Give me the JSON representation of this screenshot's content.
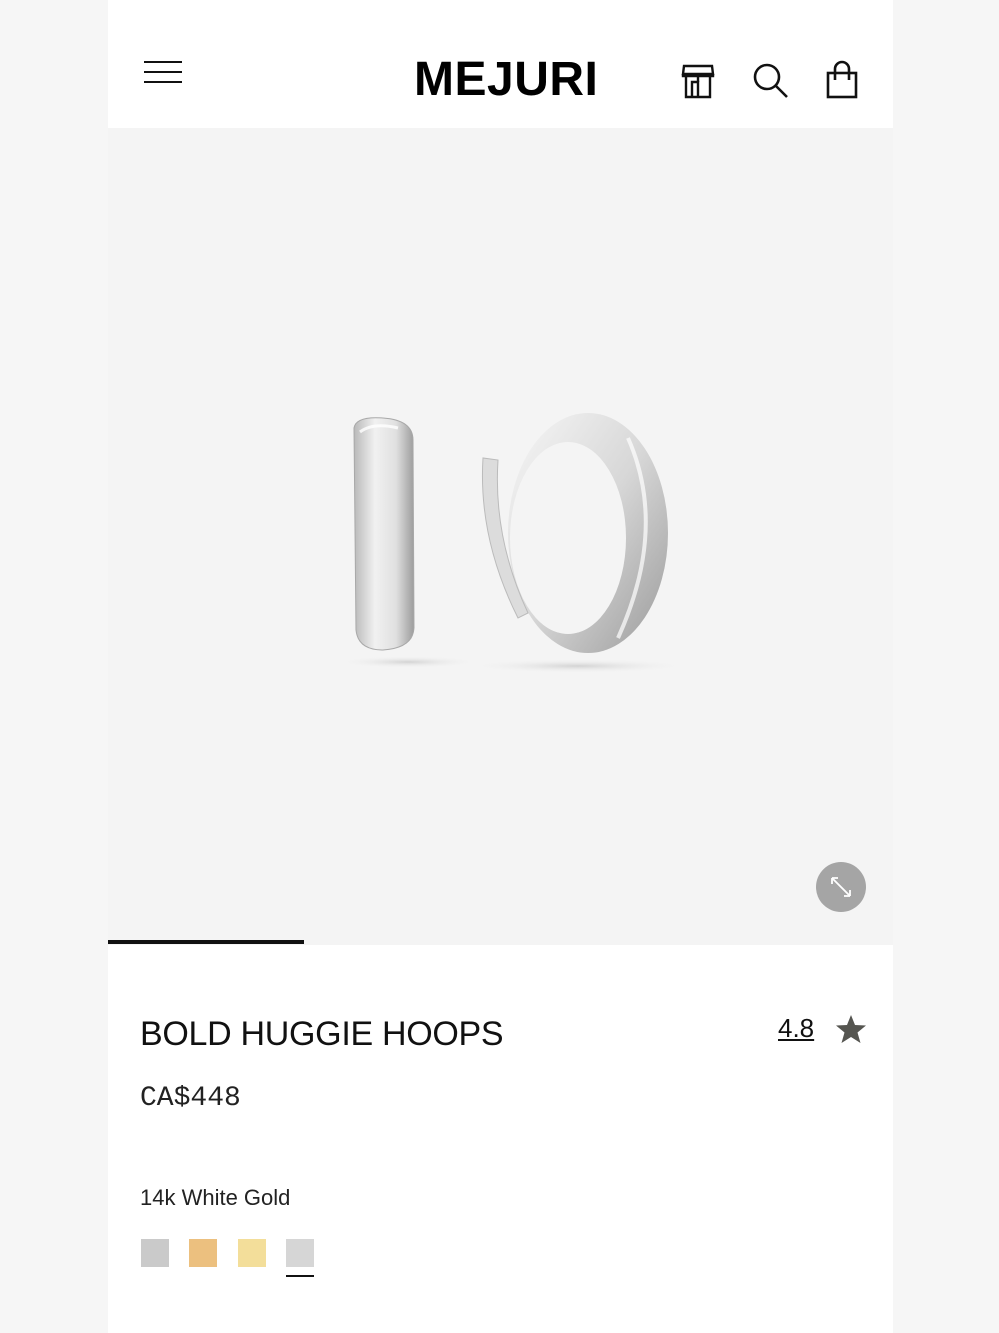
{
  "header": {
    "logo": "MEJURI",
    "icons": [
      "menu-icon",
      "store-icon",
      "search-icon",
      "bag-icon"
    ]
  },
  "gallery": {
    "image_alt": "Bold Huggie Hoops in 14k white gold",
    "slide_progress": 0.25
  },
  "product": {
    "title": "BOLD HUGGIE HOOPS",
    "rating": "4.8",
    "price": "CA$448",
    "selected_material": "14k White Gold",
    "swatch_colors": [
      "#cacaca",
      "#ecc07f",
      "#f3de9a",
      "#d6d6d6"
    ],
    "selected_swatch_index": 3
  }
}
